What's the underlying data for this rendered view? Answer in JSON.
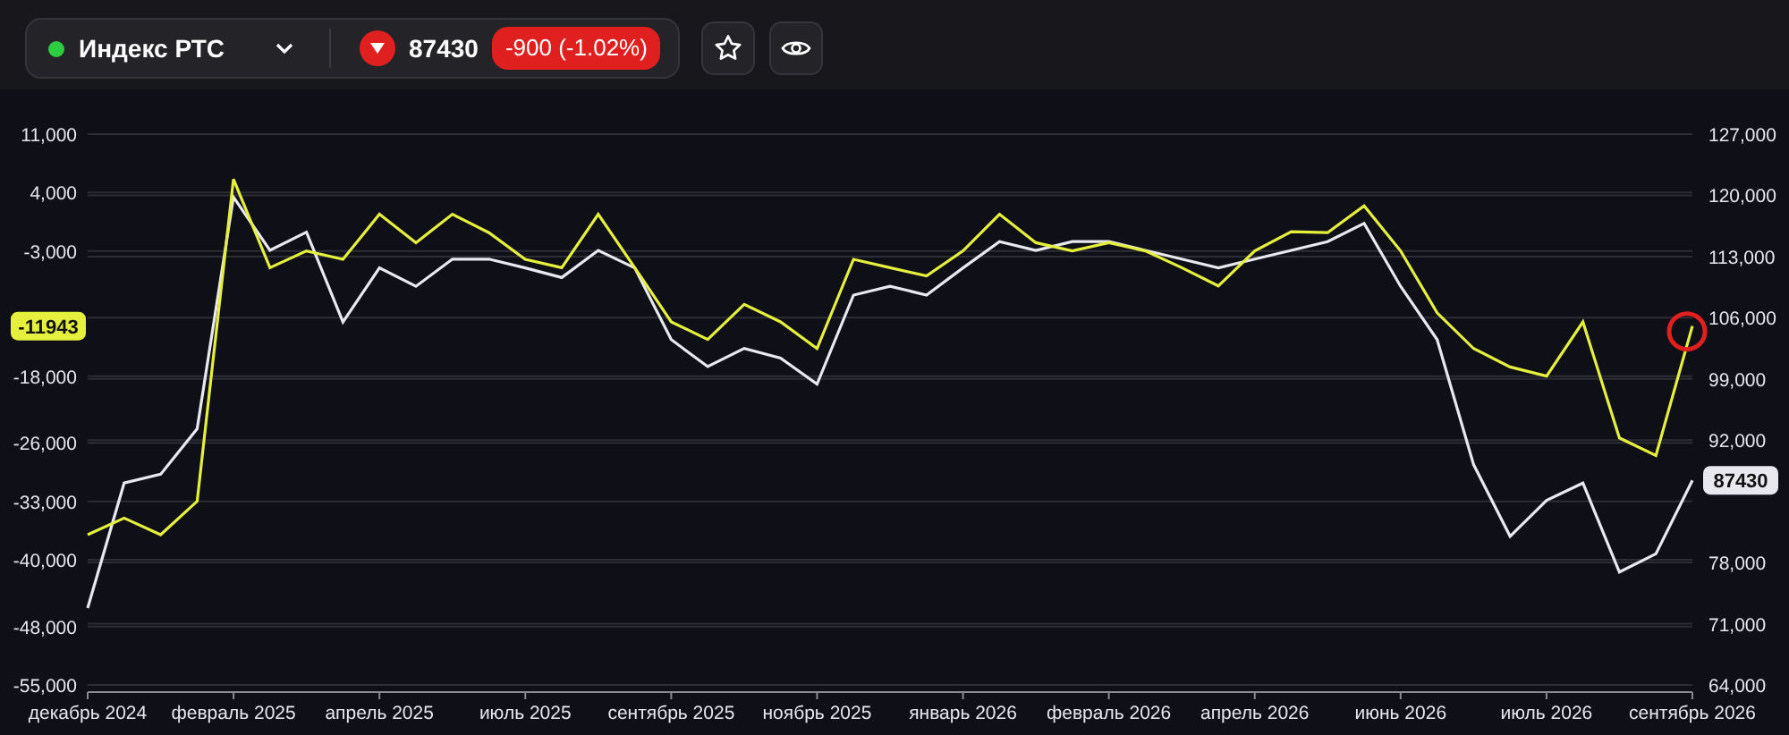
{
  "instrument": {
    "name": "Индекс РТС",
    "color": "#2ecc40",
    "expanded": false
  },
  "quote": {
    "negative": true,
    "price": "87430",
    "change": "-900 (-1.02%)"
  },
  "buttons": [
    {
      "kind": "star"
    },
    {
      "kind": "eye"
    }
  ],
  "chart": {
    "badges": [
      {
        "text": "-11943"
      },
      {
        "text": "87430"
      }
    ],
    "marker": {
      "color": "#e0201f"
    },
    "chart_data": {
      "type": "line",
      "grid": true,
      "categories": [
        "декабрь 2024",
        null,
        null,
        null,
        "февраль 2025",
        null,
        null,
        null,
        "апрель 2025",
        null,
        null,
        null,
        "июль 2025",
        null,
        null,
        null,
        "сентябрь 2025",
        null,
        null,
        null,
        "ноябрь 2025",
        null,
        null,
        null,
        "январь 2026",
        null,
        null,
        null,
        "февраль 2026",
        null,
        null,
        null,
        "апрель 2026",
        null,
        null,
        null,
        "июнь 2026",
        null,
        null,
        null,
        "июль 2026",
        null,
        null,
        null,
        "сентябрь 2026"
      ],
      "ylim": [
        -55000,
        11000
      ],
      "yticks": [
        {
          "value": 11000,
          "label": "11,000"
        },
        {
          "value": 4000,
          "label": "4,000"
        },
        {
          "value": -3000,
          "label": "-3,000"
        },
        {
          "value": -18000,
          "label": "-18,000"
        },
        {
          "value": -26000,
          "label": "-26,000"
        },
        {
          "value": -33000,
          "label": "-33,000"
        },
        {
          "value": -40000,
          "label": "-40,000"
        },
        {
          "value": -48000,
          "label": "-48,000"
        },
        {
          "value": -55000,
          "label": "-55,000"
        }
      ],
      "y2lim": [
        64000,
        127000
      ],
      "y2ticks": [
        {
          "value": 127000,
          "label": "127,000"
        },
        {
          "value": 120000,
          "label": "120,000"
        },
        {
          "value": 113000,
          "label": "113,000"
        },
        {
          "value": 106000,
          "label": "106,000"
        },
        {
          "value": 99000,
          "label": "99,000"
        },
        {
          "value": 92000,
          "label": "92,000"
        },
        {
          "value": 78000,
          "label": "78,000"
        },
        {
          "value": 71000,
          "label": "71,000"
        },
        {
          "value": 64000,
          "label": "64,000"
        }
      ],
      "series": [
        {
          "color": "#e4f03c",
          "values": [
            -37000,
            -35000,
            -37000,
            -33000,
            5600,
            -5000,
            -3000,
            -4000,
            1400,
            -2000,
            1400,
            -800,
            -4000,
            -5000,
            1400,
            -5000,
            -11500,
            -13600,
            -9400,
            -11500,
            -14700,
            -4000,
            -5000,
            -6000,
            -3000,
            1400,
            -2000,
            -3000,
            -2000,
            -3000,
            -5000,
            -7200,
            -3000,
            -700,
            -800,
            2400,
            -3000,
            -10400,
            -14700,
            -16900,
            -18000,
            -11500,
            -25400,
            -27500,
            -12000
          ]
        },
        {
          "color": "#e8e8ee",
          "axis": "y2",
          "values": [
            72800,
            87100,
            88100,
            93300,
            119800,
            113700,
            115800,
            105500,
            111700,
            109600,
            112700,
            112700,
            111700,
            110600,
            113700,
            111700,
            103500,
            100400,
            102500,
            101400,
            98400,
            108600,
            109600,
            108600,
            111700,
            114700,
            113700,
            114700,
            114700,
            113700,
            112700,
            111700,
            112700,
            113700,
            114700,
            116800,
            109600,
            103500,
            89200,
            81000,
            85100,
            87100,
            76900,
            79000,
            87400
          ]
        }
      ]
    }
  }
}
